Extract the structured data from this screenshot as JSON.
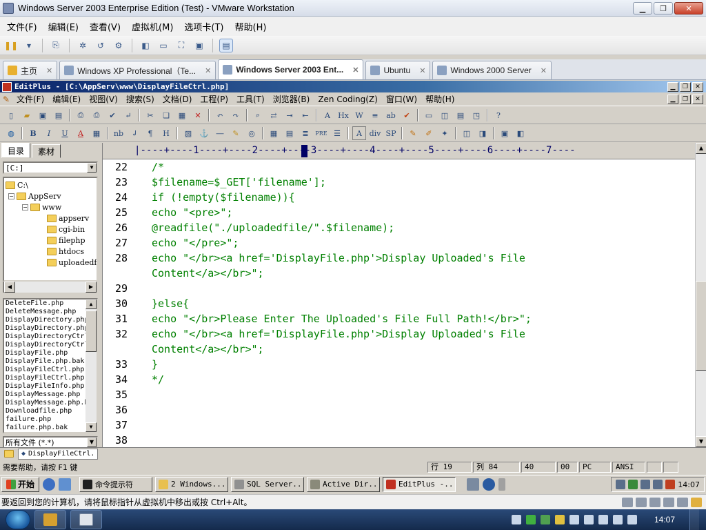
{
  "vm_window": {
    "title": "Windows Server 2003 Enterprise Edition (Test) - VMware Workstation",
    "menu": [
      "文件(F)",
      "编辑(E)",
      "查看(V)",
      "虚拟机(M)",
      "选项卡(T)",
      "帮助(H)"
    ],
    "tabs": [
      {
        "label": "主页",
        "active": false
      },
      {
        "label": "Windows XP Professional（Te...",
        "active": false
      },
      {
        "label": "Windows Server 2003 Ent...",
        "active": true
      },
      {
        "label": "Ubuntu",
        "active": false
      },
      {
        "label": "Windows 2000 Server",
        "active": false
      }
    ],
    "hint": "要返回到您的计算机，请将鼠标指针从虚拟机中移出或按 Ctrl+Alt。"
  },
  "editplus": {
    "title": "EditPlus - [C:\\AppServ\\www\\DisplayFileCtrl.php]",
    "menu": [
      "文件(F)",
      "编辑(E)",
      "视图(V)",
      "搜索(S)",
      "文档(D)",
      "工程(P)",
      "工具(T)",
      "浏览器(B)",
      "Zen Coding(Z)",
      "窗口(W)",
      "帮助(H)"
    ],
    "html_toolbar_labels": {
      "bold": "B",
      "italic": "I",
      "underline": "U",
      "nb": "nb",
      "hr": "H",
      "pre": "PRE",
      "div": "div",
      "sp": "SP"
    },
    "left_panel": {
      "tabs": [
        "目录",
        "素材"
      ],
      "drive": "[C:]",
      "tree": [
        {
          "label": "C:\\",
          "level": 0,
          "toggle": ""
        },
        {
          "label": "AppServ",
          "level": 1,
          "toggle": "−"
        },
        {
          "label": "www",
          "level": 2,
          "toggle": "−"
        },
        {
          "label": "appserv",
          "level": 3,
          "toggle": ""
        },
        {
          "label": "cgi-bin",
          "level": 3,
          "toggle": ""
        },
        {
          "label": "filephp",
          "level": 3,
          "toggle": ""
        },
        {
          "label": "htdocs",
          "level": 3,
          "toggle": ""
        },
        {
          "label": "uploadedfi",
          "level": 3,
          "toggle": ""
        }
      ],
      "files": [
        "DeleteFile.php",
        "DeleteMessage.php",
        "DisplayDirectory.php",
        "DisplayDirectory.php",
        "DisplayDirectoryCtrl",
        "DisplayDirectoryCtrl",
        "DisplayFile.php",
        "DisplayFile.php.bak",
        "DisplayFileCtrl.php",
        "DisplayFileCtrl.php.",
        "DisplayFileInfo.php",
        "DisplayMessage.php",
        "DisplayMessage.php.b",
        "Downloadfile.php",
        "failure.php",
        "failure.php.bak"
      ],
      "filter": "所有文件 (*.*)"
    },
    "ruler": "|----+----1----+----2----+----3----+----4----+----5----+----6----+----7----",
    "code_lines": [
      {
        "n": "22",
        "text": "/*"
      },
      {
        "n": "23",
        "text": "$filename=$_GET['filename'];"
      },
      {
        "n": "24",
        "text": "if (!empty($filename)){"
      },
      {
        "n": "25",
        "text": "echo \"<pre>\";"
      },
      {
        "n": "26",
        "text": "@readfile(\"./uploadedfile/\".$filename);"
      },
      {
        "n": "27",
        "text": "echo \"</pre>\";"
      },
      {
        "n": "28",
        "text": "echo \"</br><a href='DisplayFile.php'>Display Uploaded's File"
      },
      {
        "n": "",
        "text": "Content</a></br>\";"
      },
      {
        "n": "29",
        "text": ""
      },
      {
        "n": "30",
        "text": "}else{"
      },
      {
        "n": "31",
        "text": "echo \"</br>Please Enter The Uploaded's File Full Path!</br>\";"
      },
      {
        "n": "32",
        "text": "echo \"</br><a href='DisplayFile.php'>Display Uploaded's File"
      },
      {
        "n": "",
        "text": "Content</a></br>\";"
      },
      {
        "n": "33",
        "text": "}"
      },
      {
        "n": "34",
        "text": "*/"
      },
      {
        "n": "35",
        "text": ""
      },
      {
        "n": "36",
        "text": ""
      },
      {
        "n": "37",
        "text": ""
      },
      {
        "n": "38",
        "text": ""
      }
    ],
    "doc_tab": "DisplayFileCtrl.",
    "status": {
      "hint": "需要帮助，请按 F1 键",
      "line": "行 19",
      "col": "列 84",
      "n1": "40",
      "n2": "00",
      "mode": "PC",
      "encoding": "ANSI"
    }
  },
  "guest_taskbar": {
    "start": "开始",
    "buttons": [
      {
        "label": "命令提示符",
        "active": false
      },
      {
        "label": "2 Windows...",
        "active": false
      },
      {
        "label": "SQL Server...",
        "active": false
      },
      {
        "label": "Active Dir...",
        "active": false
      },
      {
        "label": "EditPlus -...",
        "active": true
      }
    ],
    "clock": "14:07"
  },
  "host_taskbar": {
    "clock": "14:07"
  },
  "colors": {
    "code_text": "#008000",
    "ruler_text": "#000066",
    "ep_title_start": "#0a246a"
  }
}
